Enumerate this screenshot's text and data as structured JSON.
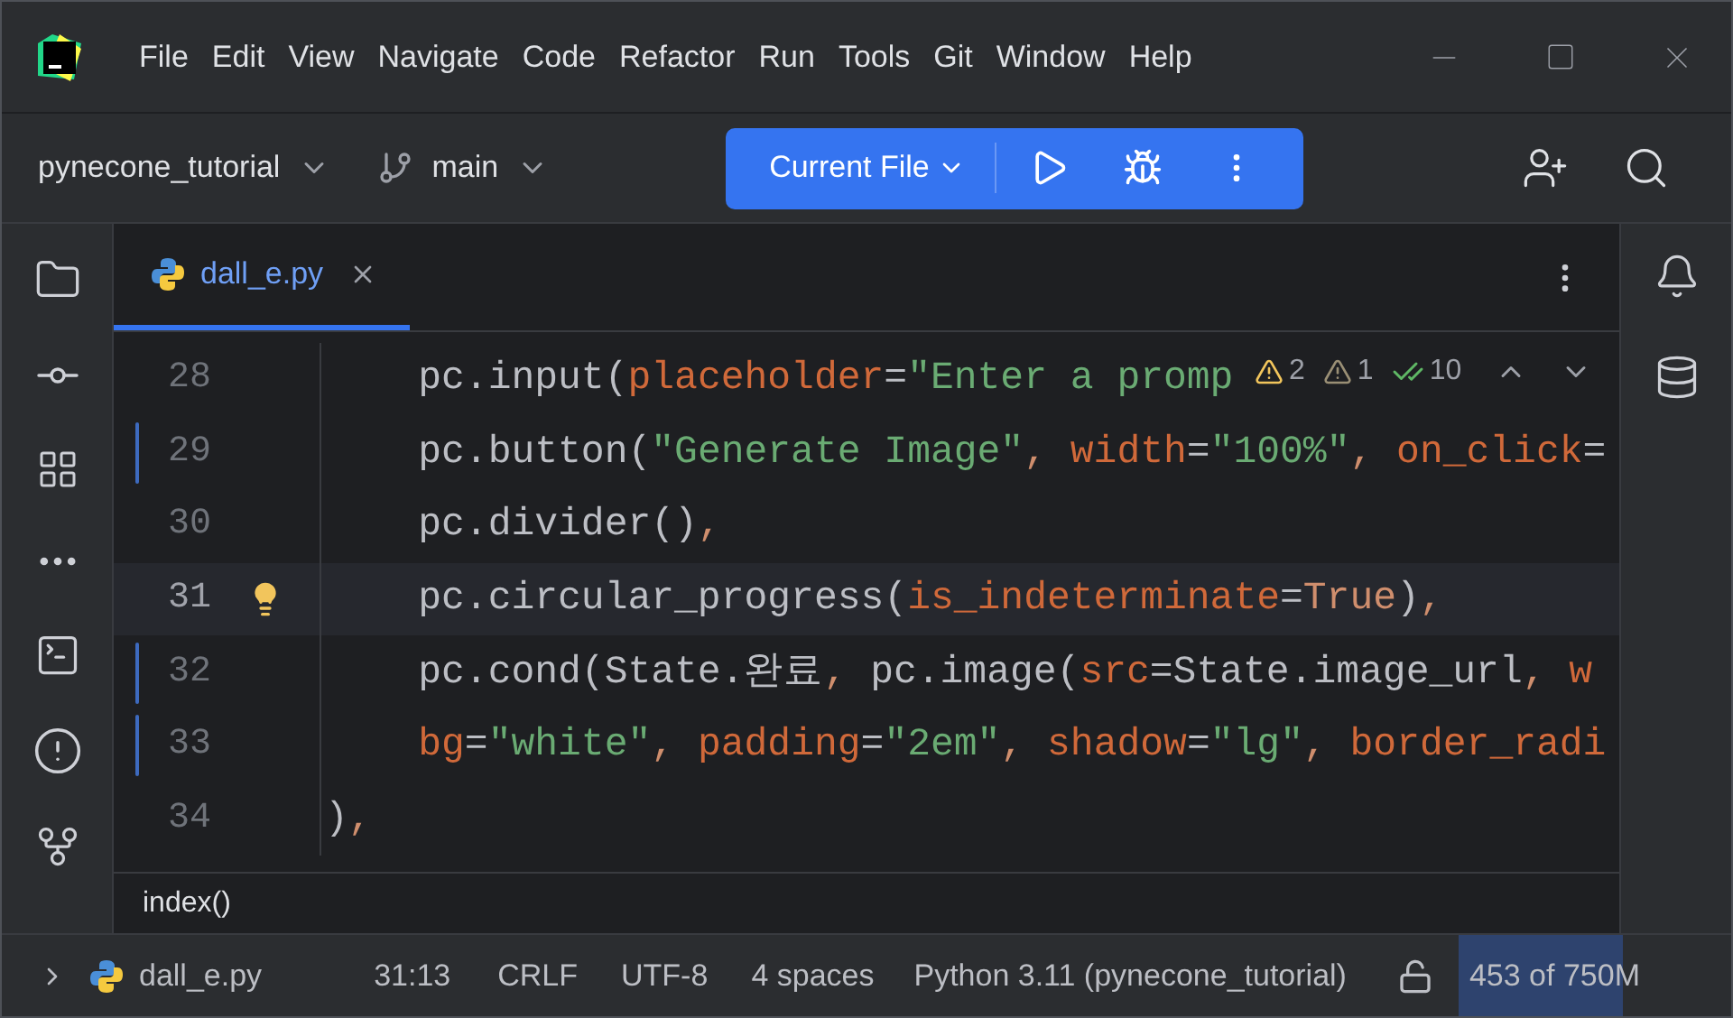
{
  "menu": [
    "File",
    "Edit",
    "View",
    "Navigate",
    "Code",
    "Refactor",
    "Run",
    "Tools",
    "Git",
    "Window",
    "Help"
  ],
  "toolbar": {
    "project": "pynecone_tutorial",
    "branch": "main",
    "run_config": "Current File"
  },
  "tabs": [
    {
      "label": "dall_e.py",
      "selected": true
    }
  ],
  "inspections": [
    {
      "kind": "error",
      "count": "2"
    },
    {
      "kind": "warning",
      "count": "1"
    },
    {
      "kind": "typo",
      "count": "10"
    }
  ],
  "lines": [
    {
      "number": "28",
      "current": false,
      "changed": false,
      "tokens": [
        {
          "kind": "plain",
          "t": "    pc.input("
        },
        {
          "kind": "arg",
          "t": "placeholder"
        },
        {
          "kind": "plain",
          "t": "="
        },
        {
          "kind": "string",
          "t": "\"Enter a promp"
        }
      ]
    },
    {
      "number": "29",
      "current": false,
      "changed": true,
      "tokens": [
        {
          "kind": "plain",
          "t": "    pc.button("
        },
        {
          "kind": "string",
          "t": "\"Generate Image\""
        },
        {
          "kind": "punct",
          "t": ", "
        },
        {
          "kind": "arg",
          "t": "width"
        },
        {
          "kind": "plain",
          "t": "="
        },
        {
          "kind": "string",
          "t": "\"100%\""
        },
        {
          "kind": "punct",
          "t": ", "
        },
        {
          "kind": "arg",
          "t": "on_click"
        },
        {
          "kind": "plain",
          "t": "="
        }
      ]
    },
    {
      "number": "30",
      "current": false,
      "changed": false,
      "tokens": [
        {
          "kind": "plain",
          "t": "    pc.divider()"
        },
        {
          "kind": "punct",
          "t": ","
        }
      ]
    },
    {
      "number": "31",
      "current": true,
      "changed": false,
      "bulb": true,
      "tokens": [
        {
          "kind": "plain",
          "t": "    pc.circular_progress("
        },
        {
          "kind": "arg",
          "t": "is_indeterminate"
        },
        {
          "kind": "plain",
          "t": "="
        },
        {
          "kind": "punct",
          "t": "True"
        },
        {
          "kind": "plain",
          "t": ")"
        },
        {
          "kind": "punct",
          "t": ","
        }
      ]
    },
    {
      "number": "32",
      "current": false,
      "changed": true,
      "tokens": [
        {
          "kind": "plain",
          "t": "    pc.cond(State.완료"
        },
        {
          "kind": "punct",
          "t": ", "
        },
        {
          "kind": "plain",
          "t": "pc.image("
        },
        {
          "kind": "arg",
          "t": "src"
        },
        {
          "kind": "plain",
          "t": "=State.image_url"
        },
        {
          "kind": "punct",
          "t": ", "
        },
        {
          "kind": "arg",
          "t": "w"
        }
      ]
    },
    {
      "number": "33",
      "current": false,
      "changed": true,
      "tokens": [
        {
          "kind": "arg",
          "t": "    bg"
        },
        {
          "kind": "plain",
          "t": "="
        },
        {
          "kind": "string",
          "t": "\"white\""
        },
        {
          "kind": "punct",
          "t": ", "
        },
        {
          "kind": "arg",
          "t": "padding"
        },
        {
          "kind": "plain",
          "t": "="
        },
        {
          "kind": "string",
          "t": "\"2em\""
        },
        {
          "kind": "punct",
          "t": ", "
        },
        {
          "kind": "arg",
          "t": "shadow"
        },
        {
          "kind": "plain",
          "t": "="
        },
        {
          "kind": "string",
          "t": "\"lg\""
        },
        {
          "kind": "punct",
          "t": ", "
        },
        {
          "kind": "arg",
          "t": "border_radi"
        }
      ]
    },
    {
      "number": "34",
      "current": false,
      "changed": false,
      "tokens": [
        {
          "kind": "plain",
          "t": ")"
        },
        {
          "kind": "punct",
          "t": ","
        }
      ]
    }
  ],
  "breadcrumb": "index()",
  "status_bar": {
    "file": "dall_e.py",
    "position": "31:13",
    "line_separator": "CRLF",
    "encoding": "UTF-8",
    "indent": "4 spaces",
    "interpreter": "Python 3.11 (pynecone_tutorial)",
    "memory": {
      "text": "453 of 750M",
      "level": 0.6
    }
  }
}
